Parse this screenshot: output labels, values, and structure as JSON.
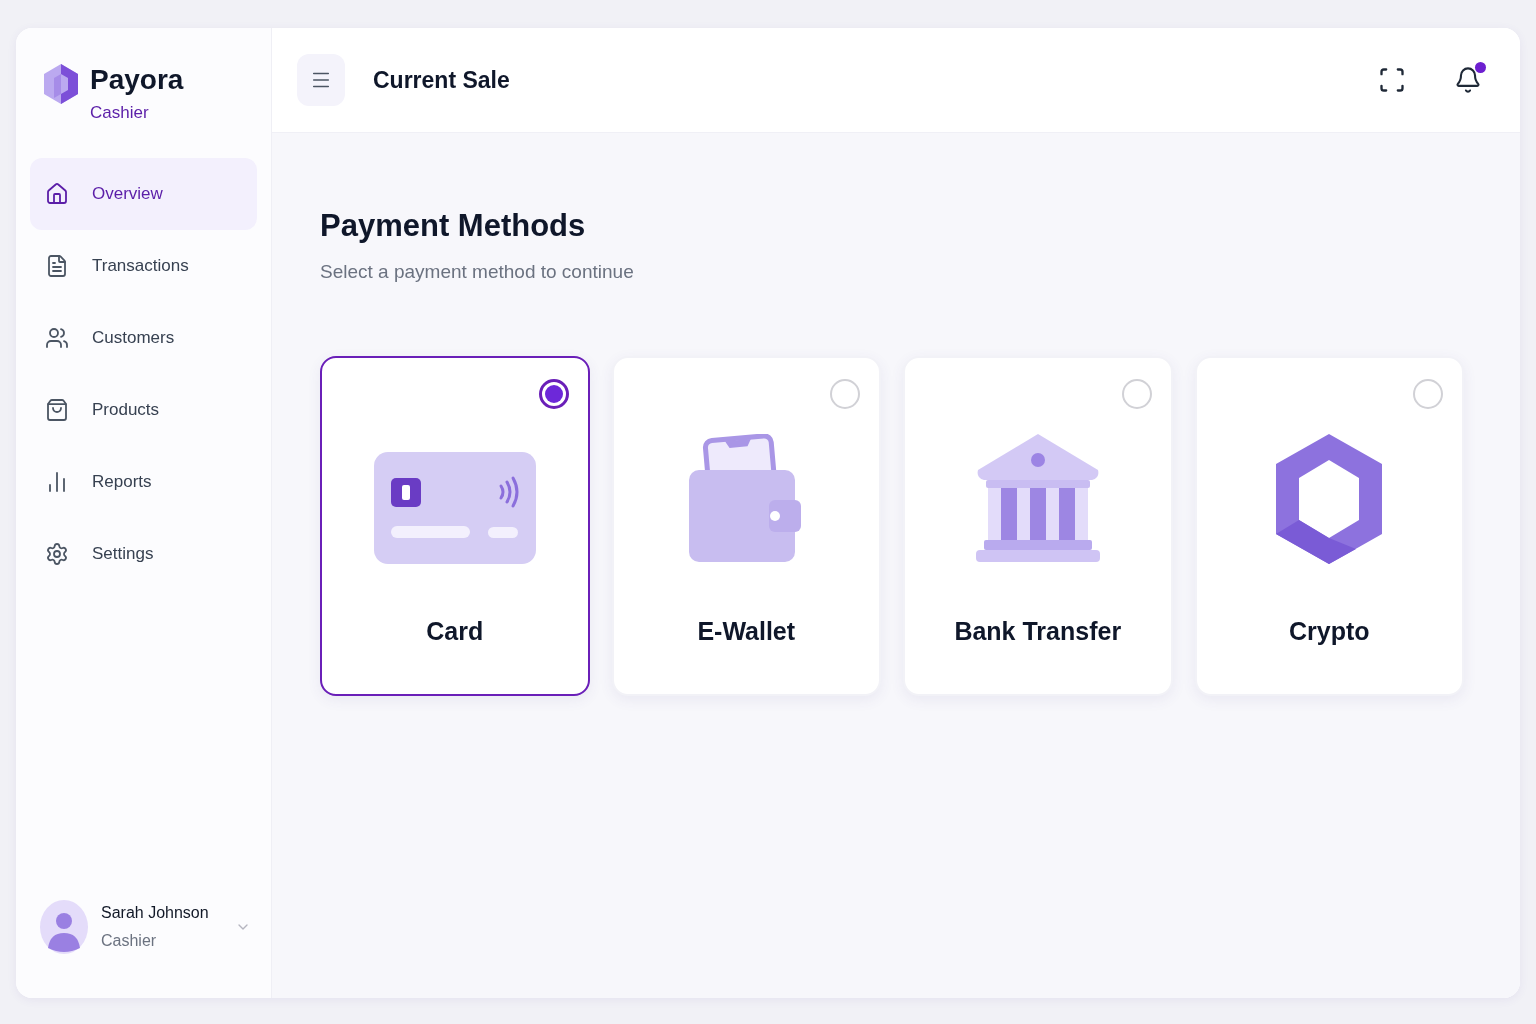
{
  "brand": {
    "name": "Payora",
    "role": "Cashier"
  },
  "sidebar": {
    "items": [
      {
        "label": "Overview",
        "kind": "home",
        "selected": true
      },
      {
        "label": "Transactions",
        "kind": "document",
        "selected": false
      },
      {
        "label": "Customers",
        "kind": "users",
        "selected": false
      },
      {
        "label": "Products",
        "kind": "bag",
        "selected": false
      },
      {
        "label": "Reports",
        "kind": "chart",
        "selected": false
      },
      {
        "label": "Settings",
        "kind": "gear",
        "selected": false
      }
    ]
  },
  "user": {
    "name": "Sarah Johnson",
    "role": "Cashier"
  },
  "header": {
    "title": "Current Sale",
    "unread_notifications": true
  },
  "page": {
    "title": "Payment Methods",
    "subtitle": "Select a payment method to continue"
  },
  "payment_methods": [
    {
      "label": "Card",
      "kind": "card",
      "selected": true
    },
    {
      "label": "E-Wallet",
      "kind": "wallet",
      "selected": false
    },
    {
      "label": "Bank Transfer",
      "kind": "bank",
      "selected": false
    },
    {
      "label": "Crypto",
      "kind": "crypto",
      "selected": false
    }
  ]
}
